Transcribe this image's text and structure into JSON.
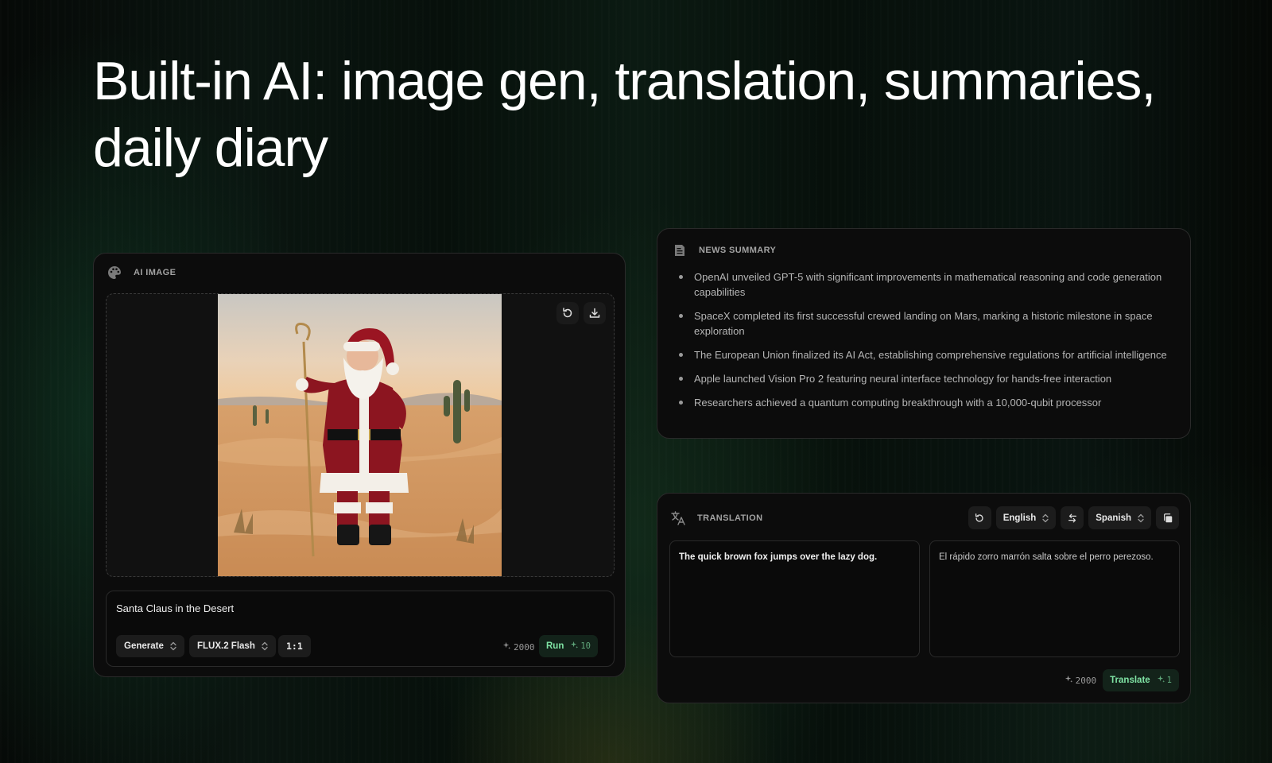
{
  "headline": "Built-in AI: image gen, translation, summaries, daily diary",
  "ai_image": {
    "title": "AI IMAGE",
    "icon": "palette-icon",
    "image_alt_icon": "generated-image",
    "actions": [
      "refresh-icon",
      "download-icon"
    ],
    "prompt": "Santa Claus in the Desert",
    "mode": "Generate",
    "model": "FLUX.2 Flash",
    "ratio": "1:1",
    "credits": "2000",
    "run_label": "Run",
    "run_cost": "10"
  },
  "news": {
    "title": "NEWS SUMMARY",
    "icon": "newspaper-icon",
    "items": [
      "OpenAI unveiled GPT-5 with significant improvements in mathematical reasoning and code generation capabilities",
      "SpaceX completed its first successful crewed landing on Mars, marking a historic milestone in space exploration",
      "The European Union finalized its AI Act, establishing comprehensive regulations for artificial intelligence",
      "Apple launched Vision Pro 2 featuring neural interface technology for hands-free interaction",
      "Researchers achieved a quantum computing breakthrough with a 10,000-qubit processor"
    ]
  },
  "translation": {
    "title": "TRANSLATION",
    "icon": "translate-icon",
    "source_lang": "English",
    "target_lang": "Spanish",
    "source_text": "The quick brown fox jumps over the lazy dog.",
    "target_text": "El rápido zorro marrón salta sobre el perro perezoso.",
    "credits": "2000",
    "translate_label": "Translate",
    "translate_cost": "1"
  },
  "colors": {
    "accent_green": "#7fe3a4",
    "card_bg": "#0c0c0c",
    "border": "#2a2a2a"
  }
}
